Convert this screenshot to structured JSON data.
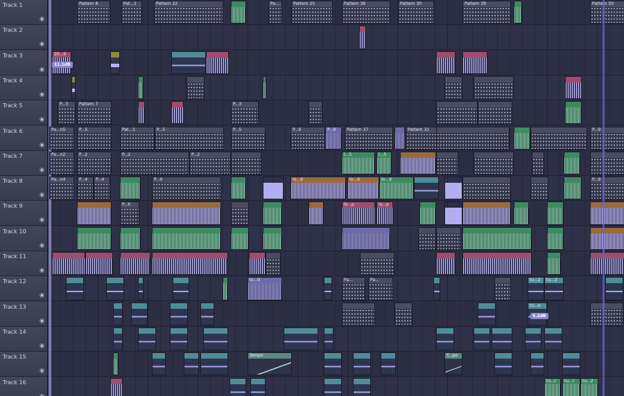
{
  "tracks": [
    {
      "label": "Track 1"
    },
    {
      "label": "Track 2"
    },
    {
      "label": "Track 3"
    },
    {
      "label": "Track 4"
    },
    {
      "label": "Track 5"
    },
    {
      "label": "Track 6"
    },
    {
      "label": "Track 7"
    },
    {
      "label": "Track 8"
    },
    {
      "label": "Track 9"
    },
    {
      "label": "Track 10"
    },
    {
      "label": "Track 11"
    },
    {
      "label": "Track 12"
    },
    {
      "label": "Track 13"
    },
    {
      "label": "Track 14"
    },
    {
      "label": "Track 15"
    },
    {
      "label": "Track 16"
    }
  ],
  "clip_labels": {
    "t1_pattern8": "Pattern 8",
    "t1_pat1": "Pat...1",
    "t1_pattern22": "Pattern 22",
    "t1_pa": "Pa...",
    "t1_pattern25": "Pattern 25",
    "t1_pattern38": "Pattern 38",
    "t1_pattern30": "Pattern 30",
    "t1_pattern39": "Pattern 39",
    "t1_pattern50": "Pattern 50",
    "t3_20": "20...6",
    "t5_p3": "P...3",
    "t5_pattern7": "Pattern 7",
    "t6_pan5": "Pa...n5",
    "t6_p5": "P...5",
    "t6_pat1": "Pat...1",
    "t6_p9": "P...9",
    "t6_pattern37": "Pattern 37",
    "t6_pattern31": "Pattern 31",
    "t7_pan2": "Pa...n2",
    "t7_p2": "P...2",
    "t7_l5": "l...5",
    "t8_pan4": "Pa...n4",
    "t8_p4": "P...4",
    "t8_p9": "P...9",
    "t8_lo_d": "lo...d",
    "t9_p6": "P...6",
    "t9_lo_p": "lo...p",
    "t12_lo_d": "lo...d",
    "t12_pa": "Pa...",
    "t12_tu2": "tu...2",
    "t13_tu_e": "tu...e",
    "t15_tempo": "Tempo",
    "t15_t_po": "T...po",
    "t16_tu_r": "tu...r",
    "t16_tu_2": "tu...2"
  },
  "badges": {
    "t3_volume": "11.1dB",
    "t13_volume": "4.2dB"
  },
  "icons": {
    "track_power": "power-button-icon",
    "pattern_clip": "pattern-icon",
    "audio_clip": "audio-clip-icon",
    "automation_clip": "automation-icon"
  },
  "colors": {
    "background": "#2c2e44",
    "header": "#3a3d4e",
    "audio_purple": "#b3aef0",
    "green": "#3e8a62",
    "orange": "#9a6a3c",
    "teal": "#4f8c98",
    "pink": "#a04c6e"
  }
}
